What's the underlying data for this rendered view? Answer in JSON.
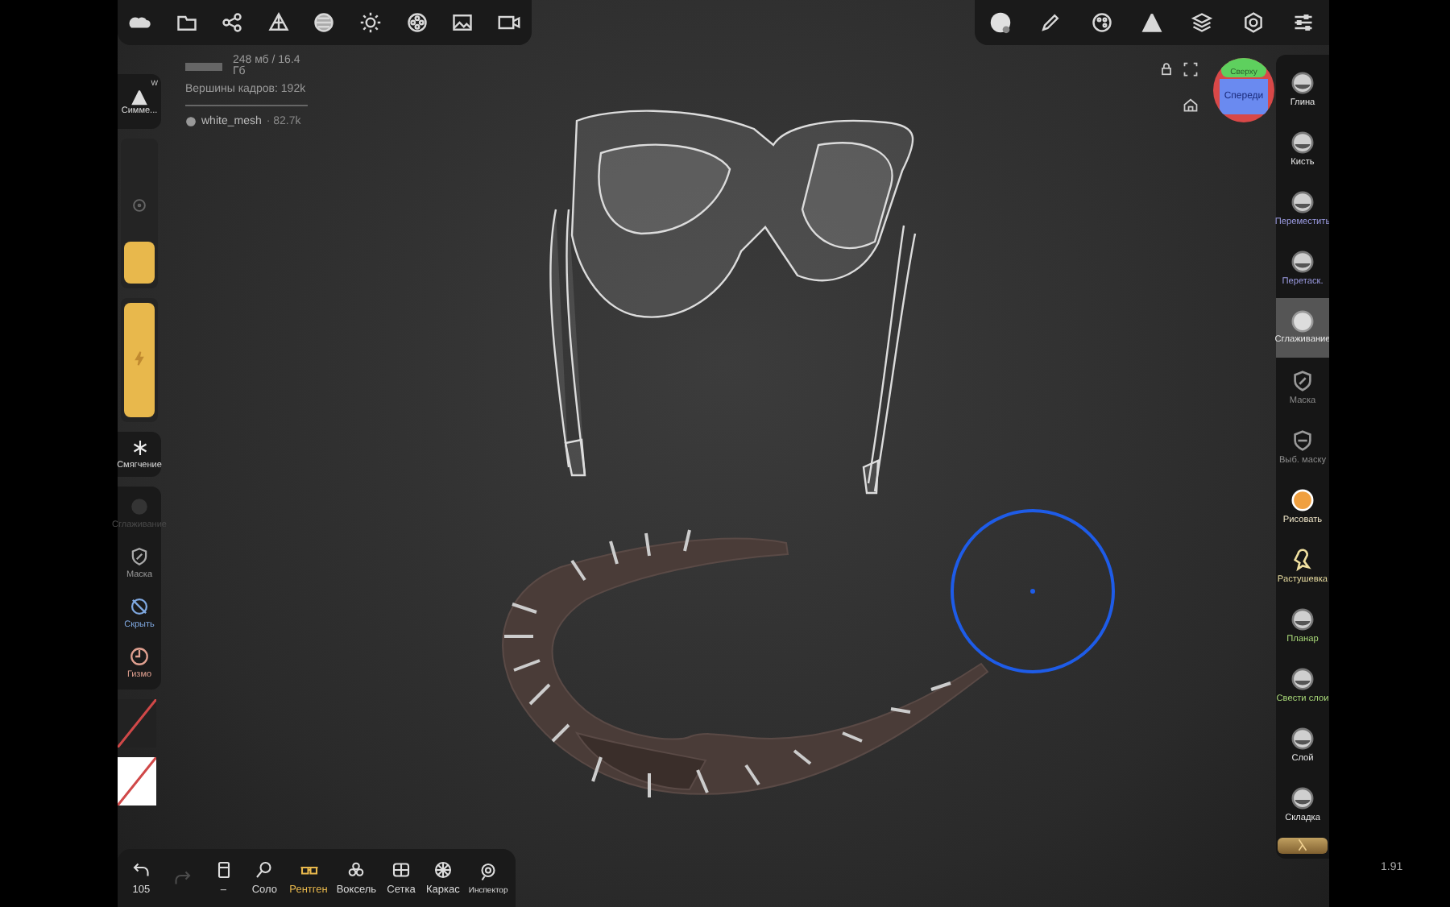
{
  "info": {
    "memory": "248 мб / 16.4 Гб",
    "vertices": "Вершины кадров: 192k",
    "mesh_name": "white_mesh",
    "mesh_count": "· 82.7k"
  },
  "left_panel": {
    "symmetry": {
      "label": "Симме...",
      "badge": "W"
    },
    "sliders": [
      {
        "level": 0.3
      },
      {
        "level": 1.0
      }
    ],
    "smoothing": "Смягчение",
    "tools": [
      {
        "label": "Сглаживание",
        "disabled": true,
        "color": "#4a4a4a"
      },
      {
        "label": "Маска",
        "disabled": false,
        "color": "#9a9a9a"
      },
      {
        "label": "Скрыть",
        "disabled": false,
        "color": "#7fa8e0"
      },
      {
        "label": "Гизмо",
        "disabled": false,
        "color": "#e0a090"
      }
    ]
  },
  "gizmo": {
    "top": "Сверху",
    "front": "Спереди"
  },
  "right_tools": [
    {
      "label": "Глина",
      "selected": false,
      "color": "#e8e8e8"
    },
    {
      "label": "Кисть",
      "selected": false,
      "color": "#e8e8e8"
    },
    {
      "label": "Переместить",
      "selected": false,
      "color": "#9a9ae0"
    },
    {
      "label": "Перетаск.",
      "selected": false,
      "color": "#9a9ae0"
    },
    {
      "label": "Сглаживание",
      "selected": true,
      "color": "#e8e8e8"
    },
    {
      "label": "Маска",
      "selected": false,
      "color": "#8a8a8a"
    },
    {
      "label": "Выб. маску",
      "selected": false,
      "color": "#8a8a8a"
    },
    {
      "label": "Рисовать",
      "selected": false,
      "color": "#f0e6c8"
    },
    {
      "label": "Растушевка",
      "selected": false,
      "color": "#e8dca0"
    },
    {
      "label": "Планар",
      "selected": false,
      "color": "#a8d878"
    },
    {
      "label": "Свести слои",
      "selected": false,
      "color": "#a8d878"
    },
    {
      "label": "Слой",
      "selected": false,
      "color": "#e8e8e8"
    },
    {
      "label": "Складка",
      "selected": false,
      "color": "#e8e8e8"
    }
  ],
  "bottom_toolbar": [
    {
      "label": "105",
      "selected": false,
      "disabled": false
    },
    {
      "selected": false,
      "disabled": true
    },
    {
      "label": "–",
      "selected": false,
      "disabled": false
    },
    {
      "label": "Соло",
      "selected": false,
      "disabled": false
    },
    {
      "label": "Рентген",
      "selected": true,
      "disabled": false
    },
    {
      "label": "Воксель",
      "selected": false,
      "disabled": false
    },
    {
      "label": "Сетка",
      "selected": false,
      "disabled": false
    },
    {
      "label": "Каркас",
      "selected": false,
      "disabled": false
    },
    {
      "label": "Инспектор",
      "selected": false,
      "disabled": false
    }
  ],
  "version": "1.91"
}
